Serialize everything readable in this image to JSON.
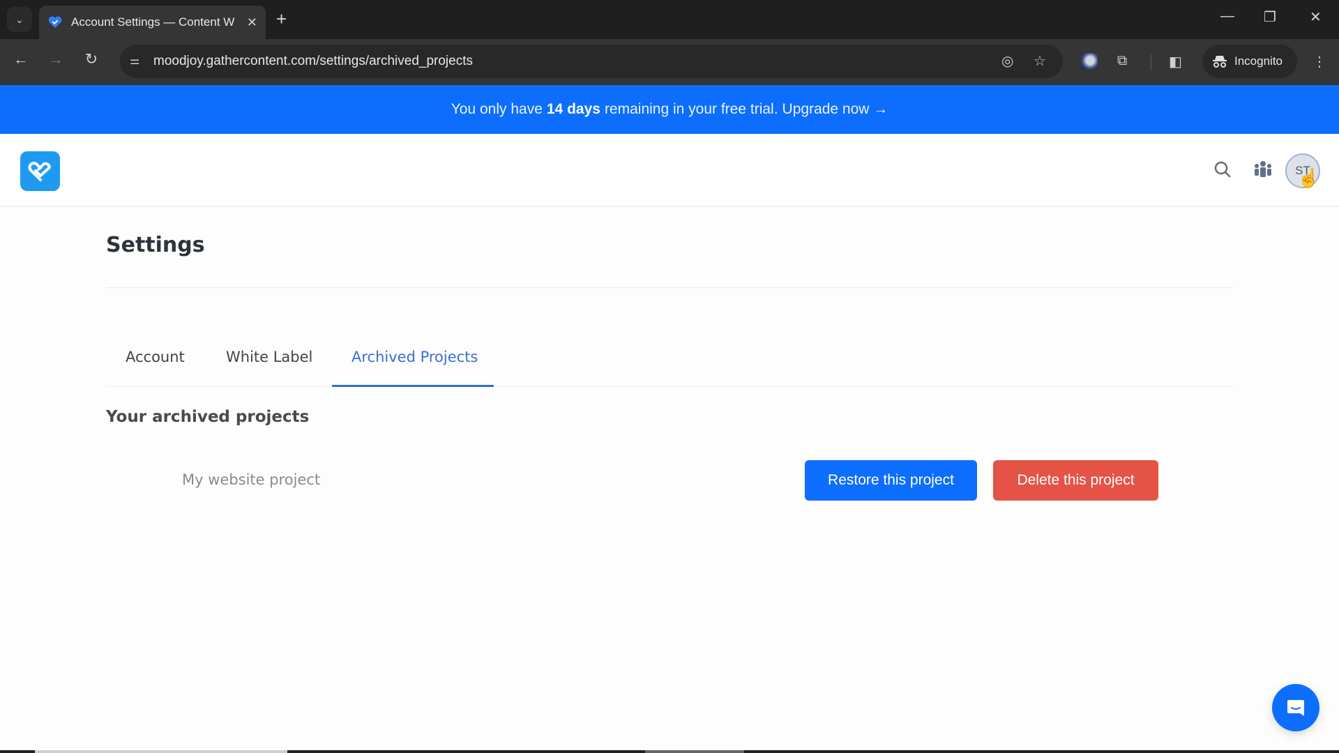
{
  "browser": {
    "tab_title": "Account Settings — Content W",
    "url": "moodjoy.gathercontent.com/settings/archived_projects",
    "profile_label": "Incognito",
    "icons": {
      "tab_list": "chevron-down-icon",
      "tab_close": "close-icon",
      "new_tab": "plus-icon",
      "back": "back-arrow-icon",
      "forward": "forward-arrow-icon",
      "reload": "reload-icon",
      "site_info": "tune-icon",
      "eye_off": "eye-off-icon",
      "bookmark": "star-icon",
      "extensions": "puzzle-icon",
      "side_panel": "side-panel-icon",
      "menu": "kebab-menu-icon"
    },
    "glyphs": {
      "tab_list": "⌄",
      "tab_close": "✕",
      "new_tab": "+",
      "minimize": "—",
      "restore": "❐",
      "close": "✕",
      "back": "←",
      "forward": "→",
      "reload": "↻",
      "site_info": "⚌",
      "eye_off": "◎",
      "bookmark": "☆",
      "extensions": "⧉",
      "side_panel": "◧",
      "menu": "⋮",
      "incognito": "🕵"
    }
  },
  "banner": {
    "prefix": "You only have",
    "highlight": "14 days",
    "suffix": "remaining in your free trial.",
    "cta": "Upgrade now →",
    "color": "#0d6efd"
  },
  "header": {
    "avatar_initials": "ST",
    "search_icon": "search-icon",
    "team_icon": "team-icon"
  },
  "page": {
    "title": "Settings",
    "tabs": [
      {
        "label": "Account",
        "active": false
      },
      {
        "label": "White Label",
        "active": false
      },
      {
        "label": "Archived Projects",
        "active": true
      }
    ],
    "section_title": "Your archived projects",
    "archived_projects": [
      {
        "name": "My website project",
        "restore_label": "Restore this project",
        "delete_label": "Delete this project"
      }
    ]
  },
  "colors": {
    "primary": "#0d6efd",
    "danger": "#e55347",
    "active_tab": "#3b6fd6",
    "logo": "#1e9bf0"
  }
}
